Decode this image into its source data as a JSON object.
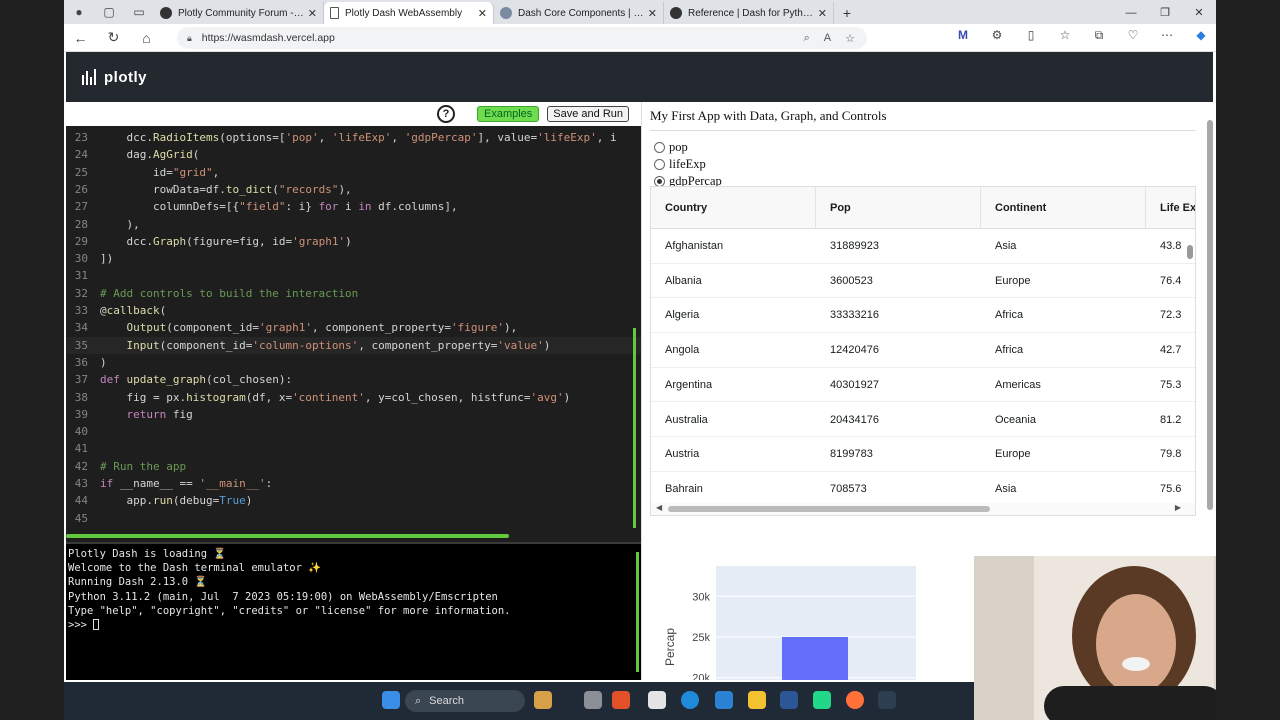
{
  "browser": {
    "tabs": [
      {
        "title": "Plotly Community Forum - The w",
        "active": false
      },
      {
        "title": "Plotly Dash WebAssembly",
        "active": true
      },
      {
        "title": "Dash Core Components | Dash fo",
        "active": false
      },
      {
        "title": "Reference | Dash for Python Doc",
        "active": false
      }
    ],
    "url": "https://wasmdash.vercel.app"
  },
  "header": {
    "logo_text": "plotly"
  },
  "editor": {
    "help_label": "?",
    "examples_label": "Examples",
    "save_run_label": "Save and Run",
    "lines": [
      {
        "n": "23",
        "code": "    dcc.RadioItems(options=['pop', 'lifeExp', 'gdpPercap'], value='lifeExp', i"
      },
      {
        "n": "24",
        "code": "    dag.AgGrid("
      },
      {
        "n": "25",
        "code": "        id=\"grid\","
      },
      {
        "n": "26",
        "code": "        rowData=df.to_dict(\"records\"),"
      },
      {
        "n": "27",
        "code": "        columnDefs=[{\"field\": i} for i in df.columns],"
      },
      {
        "n": "28",
        "code": "    ),"
      },
      {
        "n": "29",
        "code": "    dcc.Graph(figure=fig, id='graph1')"
      },
      {
        "n": "30",
        "code": "])"
      },
      {
        "n": "31",
        "code": ""
      },
      {
        "n": "32",
        "code": "# Add controls to build the interaction"
      },
      {
        "n": "33",
        "code": "@callback("
      },
      {
        "n": "34",
        "code": "    Output(component_id='graph1', component_property='figure'),"
      },
      {
        "n": "35",
        "code": "    Input(component_id='column-options', component_property='value')"
      },
      {
        "n": "36",
        "code": ")"
      },
      {
        "n": "37",
        "code": "def update_graph(col_chosen):"
      },
      {
        "n": "38",
        "code": "    fig = px.histogram(df, x='continent', y=col_chosen, histfunc='avg')"
      },
      {
        "n": "39",
        "code": "    return fig"
      },
      {
        "n": "40",
        "code": ""
      },
      {
        "n": "41",
        "code": ""
      },
      {
        "n": "42",
        "code": "# Run the app"
      },
      {
        "n": "43",
        "code": "if __name__ == '__main__':"
      },
      {
        "n": "44",
        "code": "    app.run(debug=True)"
      },
      {
        "n": "45",
        "code": ""
      }
    ]
  },
  "terminal": {
    "lines": [
      "Plotly Dash is loading ⏳",
      "Welcome to the Dash terminal emulator ✨",
      "Running Dash 2.13.0 ⏳",
      "Python 3.11.2 (main, Jul  7 2023 05:19:00) on WebAssembly/Emscripten",
      "Type \"help\", \"copyright\", \"credits\" or \"license\" for more information.",
      ">>> "
    ]
  },
  "app": {
    "title": "My First App with Data, Graph, and Controls",
    "radio_options": [
      {
        "label": "pop",
        "checked": false
      },
      {
        "label": "lifeExp",
        "checked": false
      },
      {
        "label": "gdpPercap",
        "checked": true
      }
    ],
    "grid": {
      "columns": [
        "Country",
        "Pop",
        "Continent",
        "Life Exp"
      ],
      "rows": [
        [
          "Afghanistan",
          "31889923",
          "Asia",
          "43.8"
        ],
        [
          "Albania",
          "3600523",
          "Europe",
          "76.4"
        ],
        [
          "Algeria",
          "33333216",
          "Africa",
          "72.3"
        ],
        [
          "Angola",
          "12420476",
          "Africa",
          "42.7"
        ],
        [
          "Argentina",
          "40301927",
          "Americas",
          "75.3"
        ],
        [
          "Australia",
          "20434176",
          "Oceania",
          "81.2"
        ],
        [
          "Austria",
          "8199783",
          "Europe",
          "79.8"
        ],
        [
          "Bahrain",
          "708573",
          "Asia",
          "75.6"
        ]
      ]
    }
  },
  "chart_data": {
    "type": "bar",
    "ylabel": "Percap",
    "yticks": [
      "30k",
      "25k",
      "20k"
    ],
    "ylim": [
      18000,
      32000
    ],
    "values": [
      25000
    ],
    "bar_color": "#636efa"
  },
  "taskbar": {
    "search_label": "Search"
  }
}
